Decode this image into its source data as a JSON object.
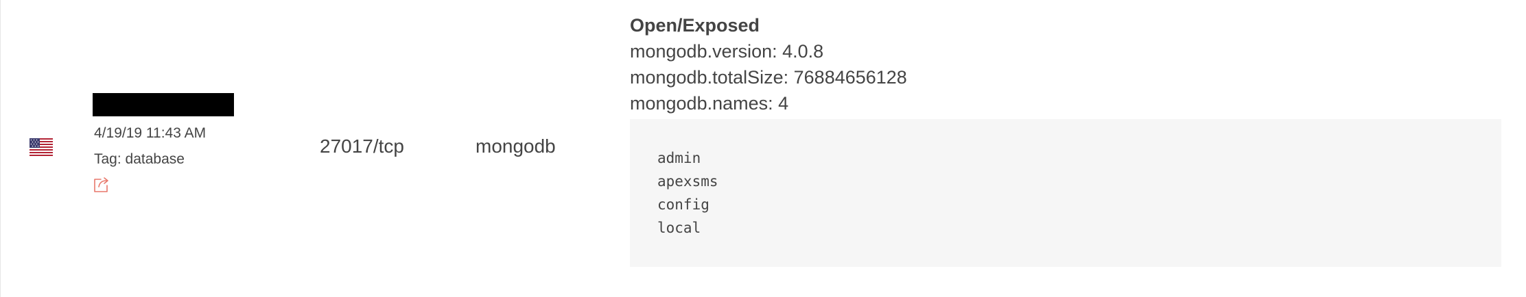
{
  "result": {
    "country_icon": "us-flag-icon",
    "timestamp": "4/19/19 11:43 AM",
    "tag": "Tag: database",
    "share_icon": "share-icon",
    "port": "27017/tcp",
    "product": "mongodb",
    "status": "Open/Exposed",
    "fields": [
      "mongodb.version: 4.0.8",
      "mongodb.totalSize: 76884656128",
      "mongodb.names: 4"
    ],
    "names": [
      "admin",
      "apexsms",
      "config",
      "local"
    ]
  },
  "colors": {
    "text": "#444444",
    "code_bg": "#f6f6f6",
    "share_icon": "#e8776a",
    "redaction": "#000000"
  }
}
